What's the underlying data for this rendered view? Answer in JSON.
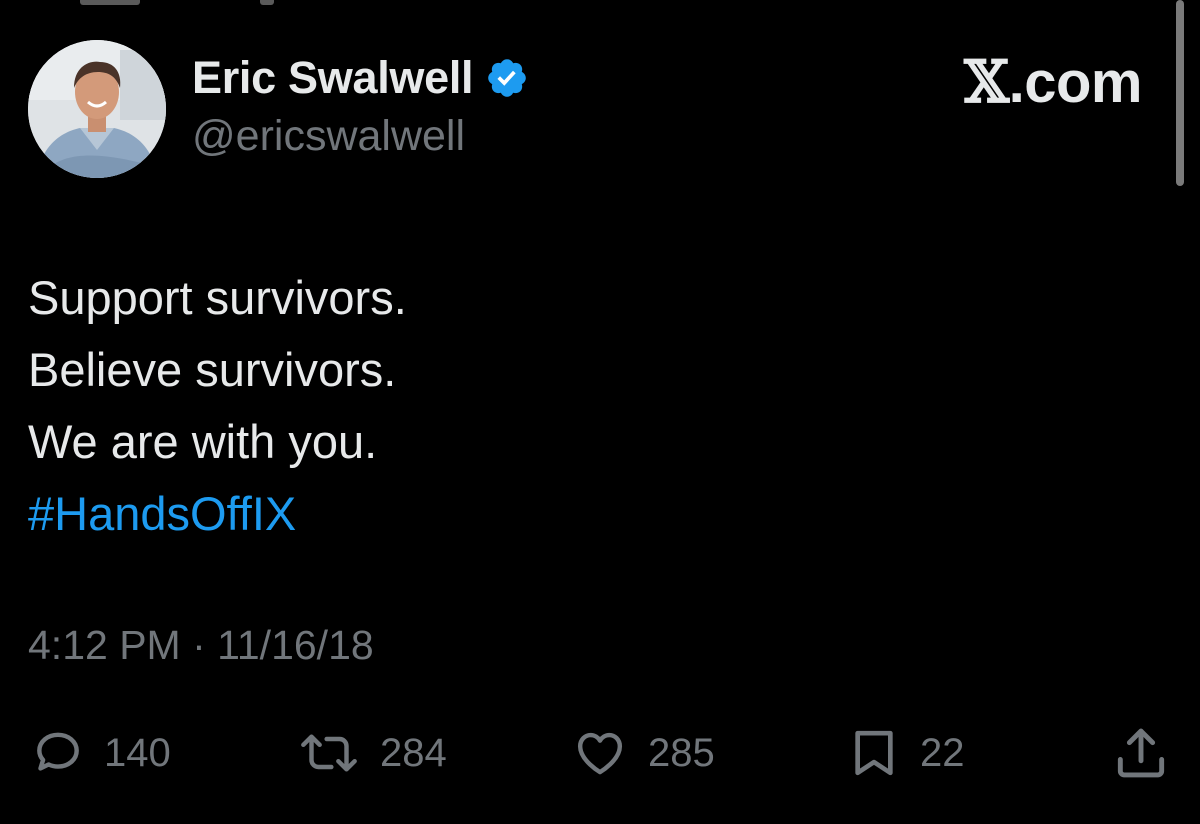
{
  "header": {
    "display_name": "Eric Swalwell",
    "handle": "@ericswalwell",
    "brand": "𝕏.com",
    "brand_mark": "𝕏",
    "brand_suffix": ".com",
    "verified_icon": "verified-badge-icon",
    "verified_color": "#1d9bf0"
  },
  "tweet": {
    "lines": [
      "Support survivors.",
      "Believe survivors.",
      "We are with you."
    ],
    "hashtag": "#HandsOffIX",
    "hashtag_color": "#1d9bf0",
    "timestamp": "4:12 PM · 11/16/18"
  },
  "actions": [
    {
      "icon": "reply-icon",
      "count": "140"
    },
    {
      "icon": "retweet-icon",
      "count": "284"
    },
    {
      "icon": "like-icon",
      "count": "285"
    },
    {
      "icon": "bookmark-icon",
      "count": "22"
    },
    {
      "icon": "share-icon",
      "count": ""
    }
  ],
  "colors": {
    "background": "#000000",
    "primary_text": "#e7e9ea",
    "secondary_text": "#71767b",
    "accent": "#1d9bf0"
  }
}
